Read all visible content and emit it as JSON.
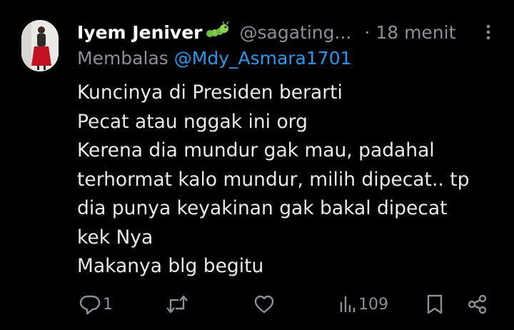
{
  "tweet": {
    "display_name": "Iyem Jeniver",
    "name_emoji": "caterpillar-emoji",
    "handle": "@sagating...",
    "separator": "·",
    "time": "18 menit",
    "replying_prefix": "Membalas",
    "replying_to": "@Mdy_Asmara1701",
    "text_lines": [
      "Kuncinya di Presiden berarti",
      "Pecat atau nggak ini org",
      "Kerena dia mundur gak mau, padahal",
      "terhormat kalo mundur, milih dipecat.. tp",
      "dia punya keyakinan gak bakal dipecat",
      "kek Nya",
      "Makanya blg begitu"
    ]
  },
  "actions": {
    "reply_count": "1",
    "retweet_count": "",
    "like_count": "",
    "views_count": "109"
  },
  "icons": {
    "reply": "reply-icon",
    "retweet": "retweet-icon",
    "like": "heart-icon",
    "views": "views-icon",
    "bookmark": "bookmark-icon",
    "share": "share-icon",
    "more": "more-icon"
  },
  "colors": {
    "background": "#000000",
    "text": "#e7e9ea",
    "secondary": "#8b9096",
    "accent": "#1d9bf0"
  }
}
